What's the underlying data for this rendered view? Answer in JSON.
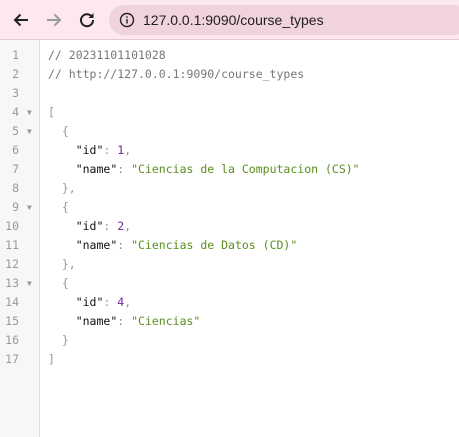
{
  "browser": {
    "url": "127.0.0.1:9090/course_types",
    "icons": {
      "back": "arrow-left-icon",
      "forward": "arrow-right-icon",
      "reload": "reload-icon",
      "site_info": "info-circle-icon"
    }
  },
  "viewer": {
    "lines": [
      {
        "n": "1",
        "fold": "",
        "parts": [
          {
            "t": "// 20231101101028",
            "c": "c-comment"
          }
        ]
      },
      {
        "n": "2",
        "fold": "",
        "parts": [
          {
            "t": "// http://127.0.0.1:9090/course_types",
            "c": "c-comment"
          }
        ]
      },
      {
        "n": "3",
        "fold": "",
        "parts": []
      },
      {
        "n": "4",
        "fold": "▼",
        "parts": [
          {
            "t": "[",
            "c": "c-punc"
          }
        ]
      },
      {
        "n": "5",
        "fold": "▼",
        "parts": [
          {
            "t": "  {",
            "c": "c-punc"
          }
        ]
      },
      {
        "n": "6",
        "fold": "",
        "parts": [
          {
            "t": "    ",
            "c": ""
          },
          {
            "t": "\"id\"",
            "c": "c-key"
          },
          {
            "t": ": ",
            "c": "c-punc"
          },
          {
            "t": "1",
            "c": "c-num"
          },
          {
            "t": ",",
            "c": "c-punc"
          }
        ]
      },
      {
        "n": "7",
        "fold": "",
        "parts": [
          {
            "t": "    ",
            "c": ""
          },
          {
            "t": "\"name\"",
            "c": "c-key"
          },
          {
            "t": ": ",
            "c": "c-punc"
          },
          {
            "t": "\"Ciencias de la Computacion (CS)\"",
            "c": "c-str"
          }
        ]
      },
      {
        "n": "8",
        "fold": "",
        "parts": [
          {
            "t": "  },",
            "c": "c-punc"
          }
        ]
      },
      {
        "n": "9",
        "fold": "▼",
        "parts": [
          {
            "t": "  {",
            "c": "c-punc"
          }
        ]
      },
      {
        "n": "10",
        "fold": "",
        "parts": [
          {
            "t": "    ",
            "c": ""
          },
          {
            "t": "\"id\"",
            "c": "c-key"
          },
          {
            "t": ": ",
            "c": "c-punc"
          },
          {
            "t": "2",
            "c": "c-num"
          },
          {
            "t": ",",
            "c": "c-punc"
          }
        ]
      },
      {
        "n": "11",
        "fold": "",
        "parts": [
          {
            "t": "    ",
            "c": ""
          },
          {
            "t": "\"name\"",
            "c": "c-key"
          },
          {
            "t": ": ",
            "c": "c-punc"
          },
          {
            "t": "\"Ciencias de Datos (CD)\"",
            "c": "c-str"
          }
        ]
      },
      {
        "n": "12",
        "fold": "",
        "parts": [
          {
            "t": "  },",
            "c": "c-punc"
          }
        ]
      },
      {
        "n": "13",
        "fold": "▼",
        "parts": [
          {
            "t": "  {",
            "c": "c-punc"
          }
        ]
      },
      {
        "n": "14",
        "fold": "",
        "parts": [
          {
            "t": "    ",
            "c": ""
          },
          {
            "t": "\"id\"",
            "c": "c-key"
          },
          {
            "t": ": ",
            "c": "c-punc"
          },
          {
            "t": "4",
            "c": "c-num"
          },
          {
            "t": ",",
            "c": "c-punc"
          }
        ]
      },
      {
        "n": "15",
        "fold": "",
        "parts": [
          {
            "t": "    ",
            "c": ""
          },
          {
            "t": "\"name\"",
            "c": "c-key"
          },
          {
            "t": ": ",
            "c": "c-punc"
          },
          {
            "t": "\"Ciencias\"",
            "c": "c-str"
          }
        ]
      },
      {
        "n": "16",
        "fold": "",
        "parts": [
          {
            "t": "  }",
            "c": "c-punc"
          }
        ]
      },
      {
        "n": "17",
        "fold": "",
        "parts": [
          {
            "t": "]",
            "c": "c-punc"
          }
        ]
      }
    ]
  }
}
